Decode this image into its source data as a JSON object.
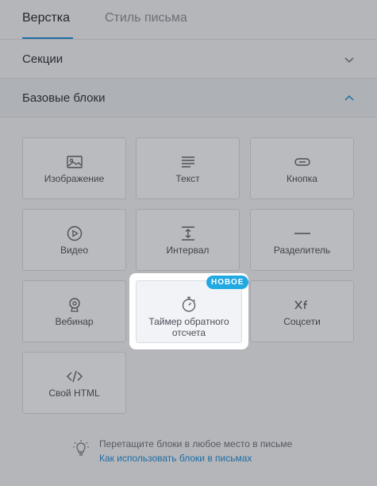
{
  "tabs": [
    {
      "label": "Верстка",
      "active": true
    },
    {
      "label": "Стиль письма",
      "active": false
    }
  ],
  "sections": [
    {
      "label": "Секции",
      "expanded": false,
      "icon": "chevron-down-icon"
    },
    {
      "label": "Базовые блоки",
      "expanded": true,
      "icon": "chevron-up-icon"
    }
  ],
  "blocks": [
    {
      "label": "Изображение",
      "icon": "image-icon"
    },
    {
      "label": "Текст",
      "icon": "text-icon"
    },
    {
      "label": "Кнопка",
      "icon": "button-icon"
    },
    {
      "label": "Видео",
      "icon": "play-icon"
    },
    {
      "label": "Интервал",
      "icon": "spacer-icon"
    },
    {
      "label": "Разделитель",
      "icon": "divider-icon"
    },
    {
      "label": "Вебинар",
      "icon": "webinar-icon"
    },
    {
      "label": "Таймер обратного отсчета",
      "icon": "timer-icon",
      "badge": "НОВОЕ",
      "highlighted": true
    },
    {
      "label": "Соцсети",
      "icon": "social-icon"
    },
    {
      "label": "Свой HTML",
      "icon": "code-icon"
    }
  ],
  "hint": {
    "text": "Перетащите блоки в любое место в письме",
    "link": "Как использовать блоки в письмах",
    "icon": "lightbulb-icon"
  },
  "colors": {
    "accent": "#1a8cd8",
    "badge": "#21a9e1",
    "overlay": "rgba(40,44,52,0.32)"
  }
}
